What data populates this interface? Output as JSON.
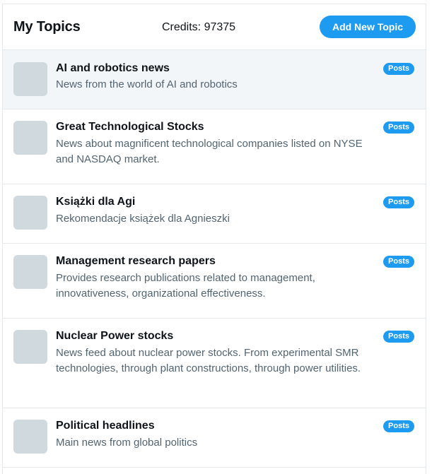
{
  "header": {
    "title": "My Topics",
    "credits": "Credits: 97375",
    "add_button": "Add New Topic"
  },
  "topics": [
    {
      "title": "AI and robotics news",
      "description": "News from the world of AI and robotics",
      "badge": "Posts",
      "selected": true
    },
    {
      "title": "Great Technological Stocks",
      "description": "News about magnificent technological companies listed on NYSE and NASDAQ market.",
      "badge": "Posts"
    },
    {
      "title": "Książki dla Agi",
      "description": "Rekomendacje książek dla Agnieszki",
      "badge": "Posts"
    },
    {
      "title": "Management research papers",
      "description": "Provides research publications related to management, innovativeness, organizational effectiveness.",
      "badge": "Posts"
    },
    {
      "title": "Nuclear Power stocks",
      "description": "News feed about nuclear power stocks. From experimental SMR technologies, through plant constructions, through power utilities.",
      "badge": "Posts"
    },
    {
      "title": "Political headlines",
      "description": "Main news from global politics",
      "badge": "Posts"
    }
  ],
  "colors": {
    "accent": "#1d9bf0",
    "avatar_placeholder": "#cfd9de",
    "selected_row": "#f3f6f9",
    "secondary_text": "#536471"
  }
}
